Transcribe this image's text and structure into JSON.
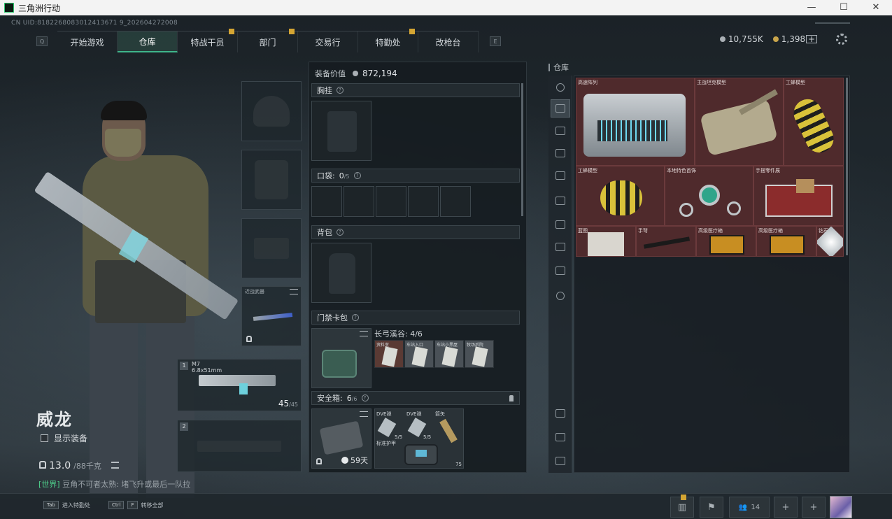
{
  "window": {
    "title": "三角洲行动"
  },
  "uid": "CN UID:8182268083012413671 9_202604272008",
  "nav": {
    "key_left": "Q",
    "key_right": "E",
    "tabs": [
      {
        "label": "开始游戏",
        "active": false,
        "badge": false
      },
      {
        "label": "仓库",
        "active": true,
        "badge": false
      },
      {
        "label": "特战干员",
        "active": false,
        "badge": true
      },
      {
        "label": "部门",
        "active": false,
        "badge": true
      },
      {
        "label": "交易行",
        "active": false,
        "badge": false
      },
      {
        "label": "特勤处",
        "active": false,
        "badge": true
      },
      {
        "label": "改枪台",
        "active": false,
        "badge": false
      }
    ]
  },
  "currency": {
    "silver": "10,755K",
    "gold": "1,398",
    "add": "+"
  },
  "operator": {
    "name": "威龙",
    "show_gear_label": "显示装备",
    "weight": "13.0",
    "weight_unit": "/88千克"
  },
  "chat": {
    "channel": "[世界]",
    "sender": "豆角不可者太熟:",
    "message": "堵飞升或最后一队拉"
  },
  "slots": {
    "melee_label": "近战武器",
    "weapon1": {
      "num": "1",
      "name": "M7",
      "caliber": "6.8x51mm",
      "ammo": "45",
      "ammo_max": "/45"
    },
    "weapon2": {
      "num": "2"
    }
  },
  "loadout": {
    "equip_value_label": "装备价值",
    "equip_value": "872,194",
    "chest_rig": "胸挂",
    "pocket_label": "口袋:",
    "pocket_count": "0",
    "pocket_max": "/5",
    "backpack": "背包",
    "keybag": "门禁卡包",
    "keybag_map": "长弓溪谷: 4/6",
    "keycards": [
      {
        "label": "资料室"
      },
      {
        "label": "车站入口"
      },
      {
        "label": "车站小黑屋"
      },
      {
        "label": "牧场后院"
      }
    ],
    "safebox_label": "安全箱:",
    "safebox_count": "6",
    "safebox_max": "/6",
    "safebox_timer": "59天",
    "safebox_items": [
      {
        "label": "DVE弹",
        "count": "5/5"
      },
      {
        "label": "DVE弹",
        "count": "5/5"
      },
      {
        "label": "箭矢"
      },
      {
        "label": "标准护甲"
      }
    ],
    "safebox_item_count": "75"
  },
  "warehouse": {
    "title": "仓库",
    "items": [
      {
        "label": "高速阵列"
      },
      {
        "label": "主战坦克模型"
      },
      {
        "label": "工蜂模型"
      },
      {
        "label": "工蜂模型"
      },
      {
        "label": "本地特色首饰"
      },
      {
        "label": "手摆零件展"
      },
      {
        "label": "蓝图"
      },
      {
        "label": "手弩"
      },
      {
        "label": "高级医疗箱"
      },
      {
        "label": "高级医疗箱"
      },
      {
        "label": "钻石"
      }
    ]
  },
  "bottom": {
    "hint_tab_key": "Tab",
    "hint_tab_label": "进入特勤处",
    "hint_ctrl_key": "Ctrl",
    "hint_f_key": "F",
    "hint_ctrl_label": "转移全部",
    "friends_count": "14"
  },
  "colors": {
    "accent_green": "#3fb58a",
    "badge_gold": "#d4a533",
    "item_red": "#4f2a2c"
  }
}
